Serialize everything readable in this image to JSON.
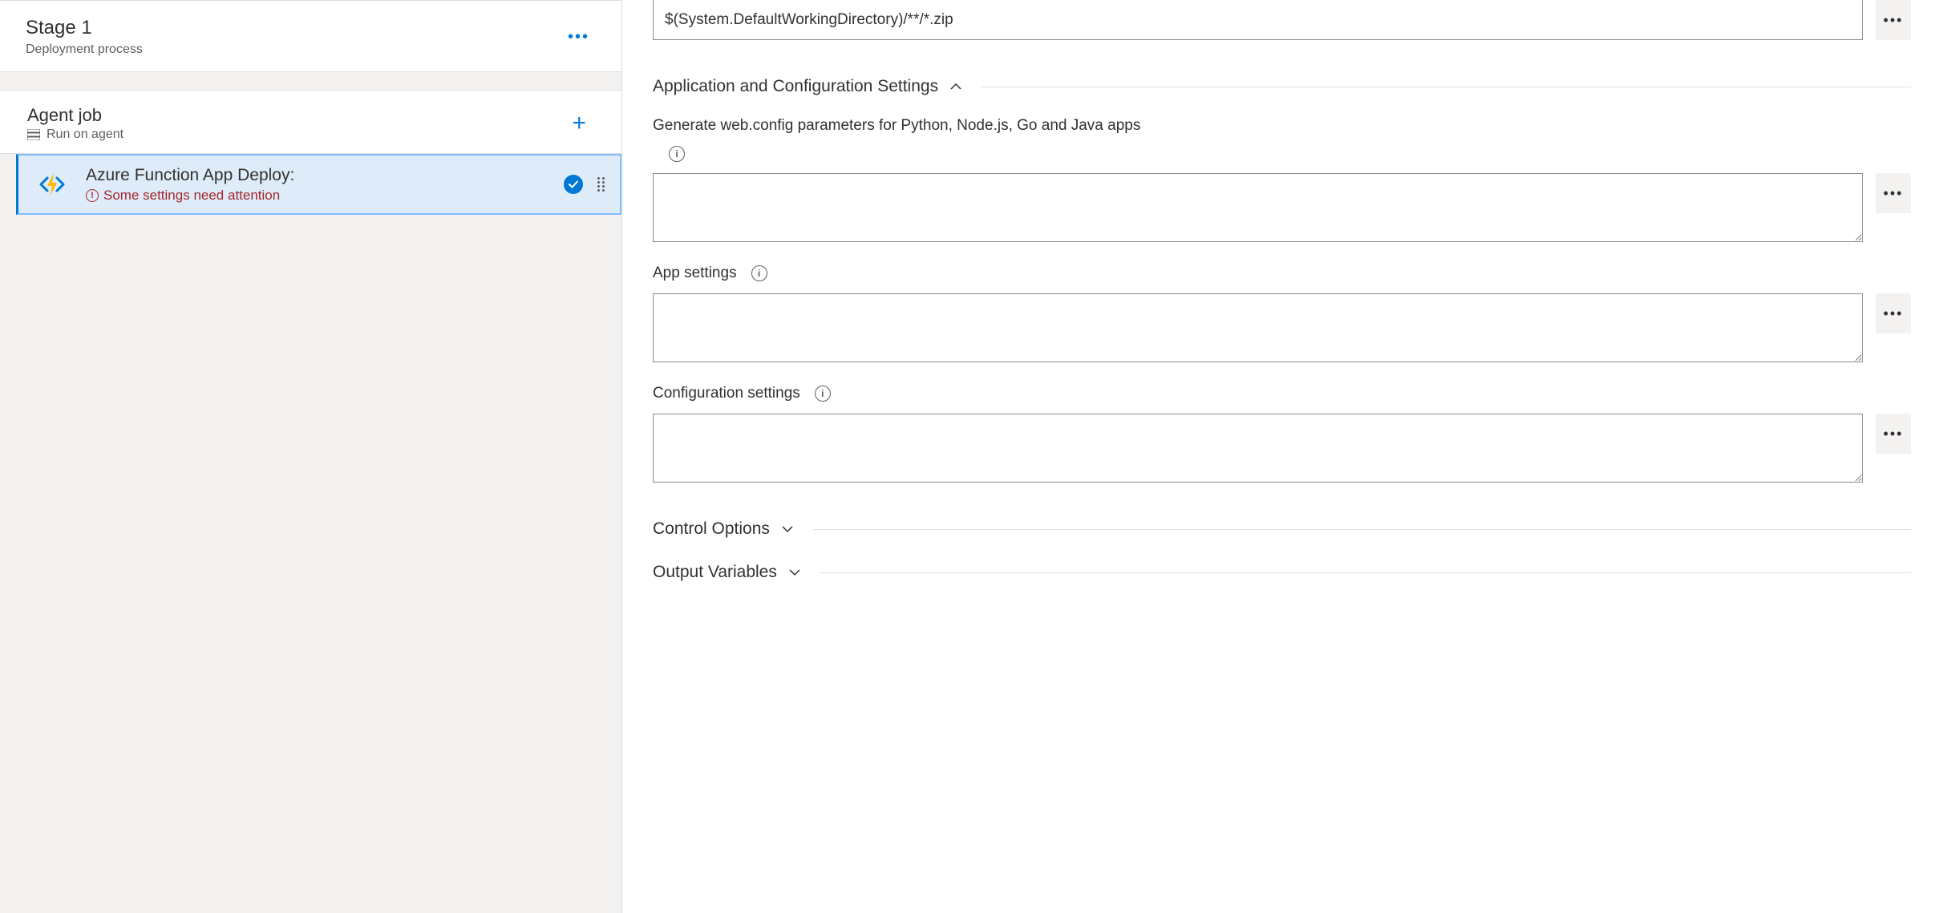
{
  "leftPanel": {
    "stage": {
      "title": "Stage 1",
      "subtitle": "Deployment process"
    },
    "agentJob": {
      "title": "Agent job",
      "subtitle": "Run on agent"
    },
    "task": {
      "title": "Azure Function App Deploy:",
      "warning": "Some settings need attention"
    }
  },
  "rightPanel": {
    "packagePath": {
      "value": "$(System.DefaultWorkingDirectory)/**/*.zip"
    },
    "sections": {
      "appConfig": {
        "title": "Application and Configuration Settings",
        "fields": {
          "webConfig": {
            "label": "Generate web.config parameters for Python, Node.js, Go and Java apps",
            "value": ""
          },
          "appSettings": {
            "label": "App settings",
            "value": ""
          },
          "configSettings": {
            "label": "Configuration settings",
            "value": ""
          }
        }
      },
      "controlOptions": {
        "title": "Control Options"
      },
      "outputVariables": {
        "title": "Output Variables"
      }
    }
  }
}
